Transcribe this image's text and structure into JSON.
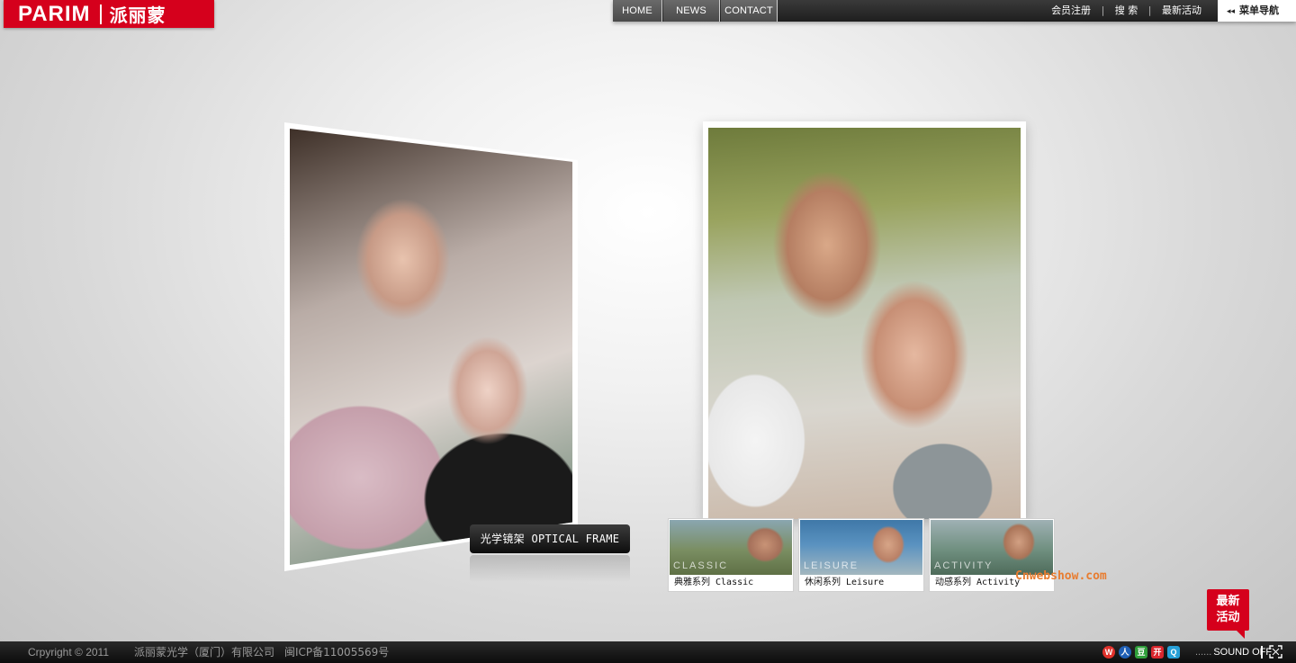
{
  "logo": {
    "en": "PARIM",
    "cn": "派丽蒙"
  },
  "nav": {
    "home": "HOME",
    "news": "NEWS",
    "contact": "CONTACT",
    "register": "会员注册",
    "search": "搜 索",
    "events": "最新活动",
    "divider": "|",
    "menu": "菜单导航",
    "menu_arrow": "◂◂"
  },
  "optical_label": "光学镜架 OPTICAL FRAME",
  "series": [
    {
      "caption": "典雅系列 Classic",
      "watermark": "CLASSIC"
    },
    {
      "caption": "休闲系列 Leisure",
      "watermark": "LEISURE"
    },
    {
      "caption": "动感系列 Activity",
      "watermark": "ACTIVITY"
    }
  ],
  "site_watermark": "Cnwebshow.com",
  "badge": {
    "line1": "最新",
    "line2": "活动"
  },
  "footer": {
    "copyright": "Crpyright © 2011",
    "company": "派丽蒙光学（厦门）有限公司",
    "icp": "闽ICP备11005569号",
    "sound_dots": "......",
    "sound": "SOUND OFF"
  },
  "social_icons": [
    "weibo-icon",
    "renren-icon",
    "douban-icon",
    "kaixin-icon",
    "qq-icon"
  ],
  "colors": {
    "brand_red": "#d5001c",
    "nav_dark": "#1e1e1e",
    "watermark_orange": "#e87c2f"
  }
}
